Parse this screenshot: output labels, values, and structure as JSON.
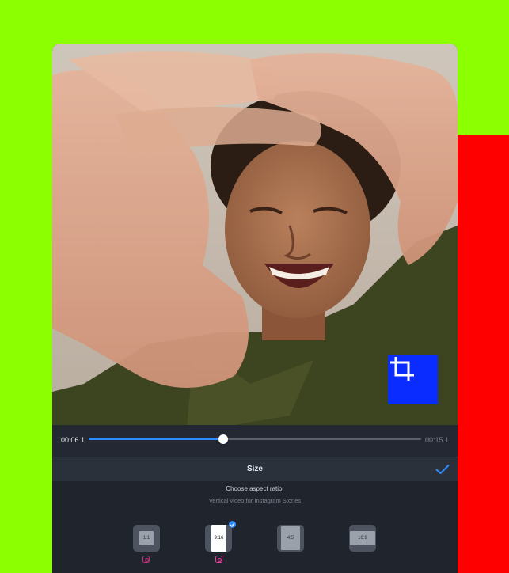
{
  "colors": {
    "background": "#8cff00",
    "accent_panel": "#ff0000",
    "crop_badge": "#0a2cff",
    "progress": "#2f8cff",
    "instagram": "#c4317f"
  },
  "player": {
    "current_time": "00:06.1",
    "total_time": "00:15.1",
    "progress": 0.405
  },
  "size_panel": {
    "title": "Size",
    "confirm_icon": "checkmark-icon",
    "prompt": "Choose aspect ratio:",
    "hint": "Vertical video for Instagram Stories",
    "ratios": [
      {
        "label": "1:1",
        "selected": false,
        "instagram": true
      },
      {
        "label": "9:16",
        "selected": true,
        "instagram": true
      },
      {
        "label": "4:5",
        "selected": false,
        "instagram": false
      },
      {
        "label": "16:9",
        "selected": false,
        "instagram": false
      }
    ]
  },
  "icons": {
    "crop": "crop-icon",
    "instagram": "instagram-icon"
  }
}
